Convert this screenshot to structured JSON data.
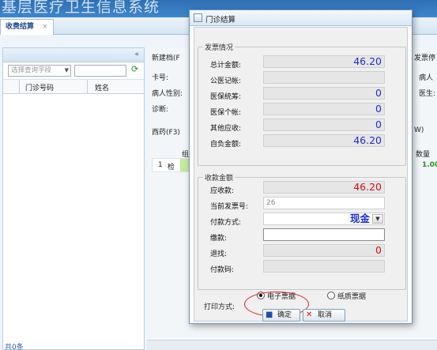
{
  "app": {
    "title": "基层医疗卫生信息系统"
  },
  "tabs": [
    {
      "label": "收费结算",
      "close": "×"
    }
  ],
  "left_panel": {
    "collapse": "«",
    "search_select": "选择查询字段",
    "columns": [
      "门诊号码",
      "姓名"
    ],
    "count": "共0条"
  },
  "background": {
    "new_file": "新建档(F",
    "invoice_stop": "发票停",
    "card_no": "卡号:",
    "sex": "病人性别:",
    "diagnosis": "诊断:",
    "patient_short": "病人",
    "doctor": "医生:",
    "west_med": "西药(F3)",
    "w_label": "W)",
    "group_col": "组",
    "qty_col": "数量",
    "row_no": "1",
    "row_item": "检",
    "row_qty": "1.00"
  },
  "dialog": {
    "title": "门诊结算",
    "invoice_group": {
      "legend": "发票情况",
      "rows": [
        {
          "label": "总计金额:",
          "value": "46.20"
        },
        {
          "label": "公医记帐:",
          "value": ""
        },
        {
          "label": "医保统筹:",
          "value": "0"
        },
        {
          "label": "医保个帐:",
          "value": "0"
        },
        {
          "label": "其他应收:",
          "value": "0"
        },
        {
          "label": "自负金额:",
          "value": "46.20"
        }
      ]
    },
    "payment_group": {
      "legend": "收款金额",
      "receivable_label": "应收款:",
      "receivable_value": "46.20",
      "invoice_no_label": "当前发票号:",
      "invoice_no_value": "26",
      "method_label": "付款方式:",
      "method_value": "现金",
      "paid_label": "缴款:",
      "paid_value": "",
      "change_label": "退找:",
      "change_value": "0",
      "pay_code_label": "付款码:",
      "pay_code_value": ""
    },
    "print": {
      "label": "打印方式:",
      "options": [
        {
          "label": "电子票据",
          "selected": true
        },
        {
          "label": "纸质票据",
          "selected": false
        }
      ]
    },
    "buttons": {
      "ok": "确定",
      "cancel": "取消"
    }
  },
  "colors": {
    "header": "#2f6fb3",
    "value_blue": "#1c2fd0",
    "value_red": "#d21414",
    "highlight": "#d7262e"
  }
}
